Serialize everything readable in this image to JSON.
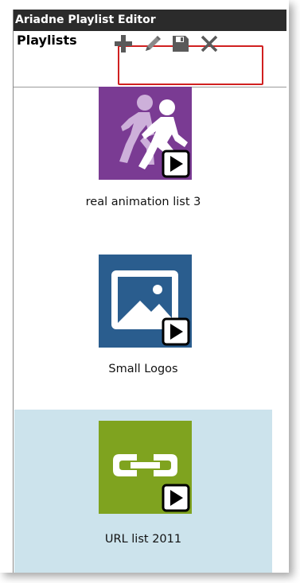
{
  "window": {
    "title": "Ariadne Playlist Editor"
  },
  "toolbar": {
    "label": "Playlists",
    "buttons": [
      {
        "icon": "plus-icon",
        "action": "add"
      },
      {
        "icon": "pencil-icon",
        "action": "edit"
      },
      {
        "icon": "save-icon",
        "action": "save"
      },
      {
        "icon": "close-icon",
        "action": "delete"
      }
    ],
    "icon_color": "#5a5a5a",
    "highlight_color": "#d02020"
  },
  "playlists": [
    {
      "label": "real animation list 3",
      "icon": "walking-people-icon",
      "tile_color": "#7a3b93",
      "selected": false
    },
    {
      "label": "Small Logos",
      "icon": "image-icon",
      "tile_color": "#2a5d8e",
      "selected": false
    },
    {
      "label": "URL list 2011",
      "icon": "link-icon",
      "tile_color": "#7fa31f",
      "selected": true
    }
  ],
  "colors": {
    "titlebar_bg": "#2b2b2b",
    "selected_bg": "#cce3ec"
  }
}
